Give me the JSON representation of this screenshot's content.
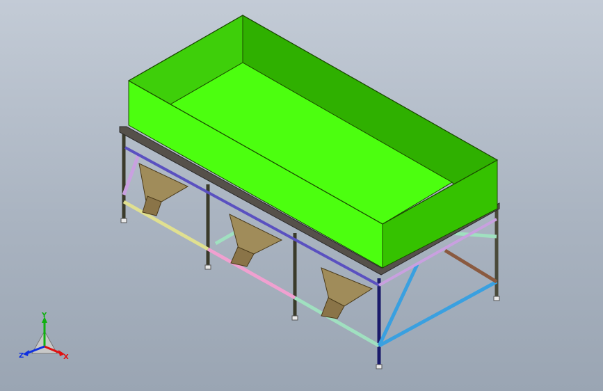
{
  "viewport": {
    "background_top": "#c3cbd6",
    "background_bottom": "#9aa5b3"
  },
  "model": {
    "hopper_color": "#4cff0f",
    "hopper_inner_color": "#3ecf0a",
    "funnel_color": "#a08c5a",
    "frame_colors": [
      "#1a1a6a",
      "#3aa0e0",
      "#c9a0e0",
      "#e0e090",
      "#f0a0d0",
      "#a0e0c0",
      "#8a5a40",
      "#3a3a2a"
    ],
    "funnel_count": 3
  },
  "triad": {
    "x_label": "X",
    "y_label": "Y",
    "z_label": "Z",
    "x_color": "#e01010",
    "y_color": "#10b010",
    "z_color": "#1030e0"
  }
}
